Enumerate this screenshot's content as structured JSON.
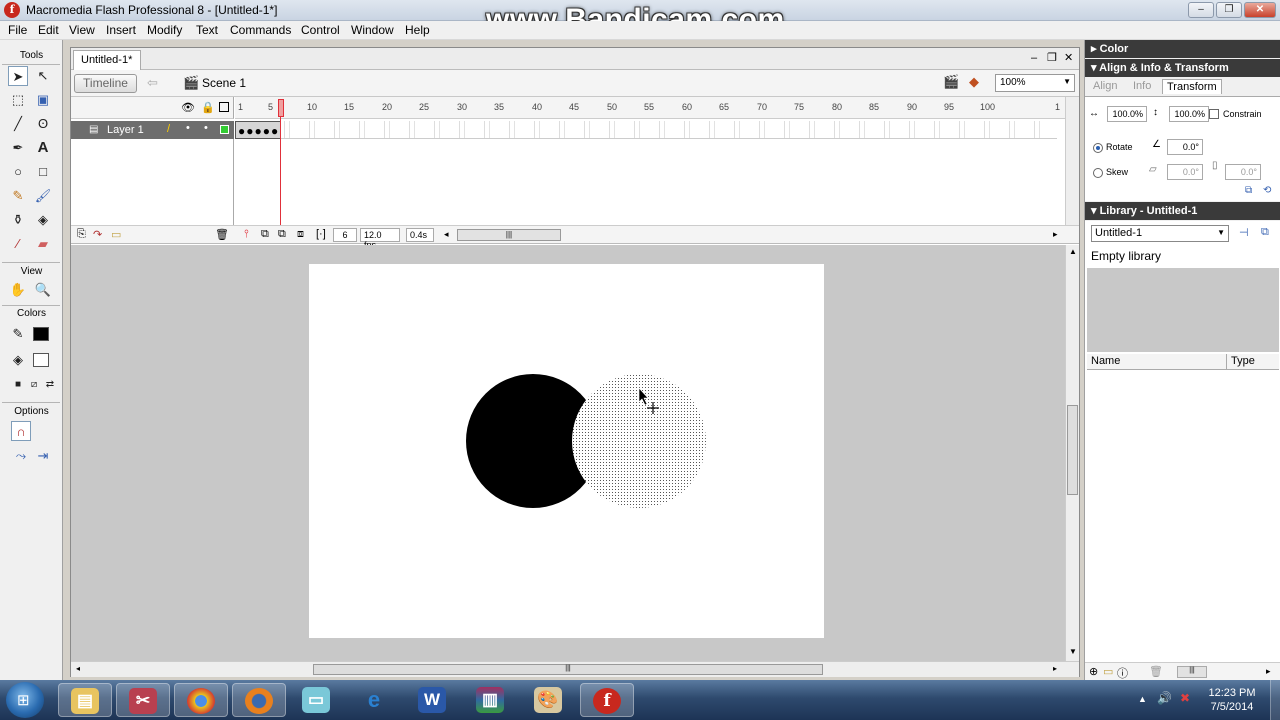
{
  "window": {
    "title": "Macromedia Flash Professional 8 - [Untitled-1*]",
    "app_icon": "f",
    "watermark": "www.Bandicam.com",
    "controls": {
      "minimize": "–",
      "restore": "❐",
      "close": "✕"
    }
  },
  "menu": [
    "File",
    "Edit",
    "View",
    "Insert",
    "Modify",
    "Text",
    "Commands",
    "Control",
    "Window",
    "Help"
  ],
  "tools": {
    "title": "Tools",
    "view_label": "View",
    "colors_label": "Colors",
    "options_label": "Options"
  },
  "document": {
    "tab": "Untitled-1*",
    "timeline_button": "Timeline",
    "scene": "Scene 1",
    "zoom": "100%"
  },
  "timeline": {
    "layer_name": "Layer 1",
    "ruler": [
      "1",
      "5",
      "10",
      "15",
      "20",
      "25",
      "30",
      "35",
      "40",
      "45",
      "50",
      "55",
      "60",
      "65",
      "70",
      "75",
      "80",
      "85",
      "90",
      "95",
      "100",
      "1"
    ],
    "current_frame": "6",
    "fps": "12.0 fps",
    "time": "0.4s"
  },
  "panels": {
    "color_header": "Color",
    "align_header": "Align & Info & Transform",
    "tabs": [
      "Align",
      "Info",
      "Transform"
    ],
    "active_tab": "Transform",
    "width_pct": "100.0%",
    "height_pct": "100.0%",
    "constrain": "Constrain",
    "rotate_label": "Rotate",
    "rotate_value": "0.0°",
    "skew_label": "Skew",
    "skew_h": "0.0°",
    "skew_v": "0.0°",
    "library_header": "Library - Untitled-1",
    "library_select": "Untitled-1",
    "library_empty": "Empty library",
    "col_name": "Name",
    "col_type": "Type"
  },
  "taskbar": {
    "time": "12:23 PM",
    "date": "7/5/2014"
  },
  "colors": {
    "stage_bg": "#ffffff",
    "work_bg": "#c8c8c8",
    "layer_selected": "#6d6d6d",
    "playhead": "#e0303a"
  }
}
